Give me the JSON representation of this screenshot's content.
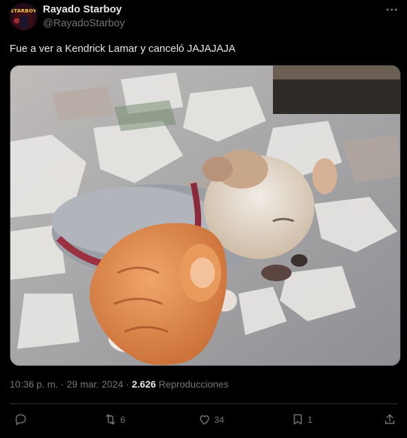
{
  "author": {
    "display_name": "Rayado Starboy",
    "handle": "@RayadoStarboy",
    "avatar_text": "STARBOY"
  },
  "tweet": {
    "text": "Fue a ver a Kendrick Lamar y canceló JAJAJAJA"
  },
  "media": {
    "description_icon": "photo-puppy-pointing-hand"
  },
  "meta": {
    "time": "10:36 p. m.",
    "separator": "·",
    "date": "29 mar. 2024",
    "views_count": "2.626",
    "views_label": "Reproducciones"
  },
  "actions": {
    "reply_count": "",
    "retweet_count": "6",
    "like_count": "34",
    "bookmark_count": "1"
  },
  "colors": {
    "background": "#000000",
    "text_primary": "#e7e9ea",
    "text_secondary": "#71767b",
    "divider": "#2f3336"
  }
}
